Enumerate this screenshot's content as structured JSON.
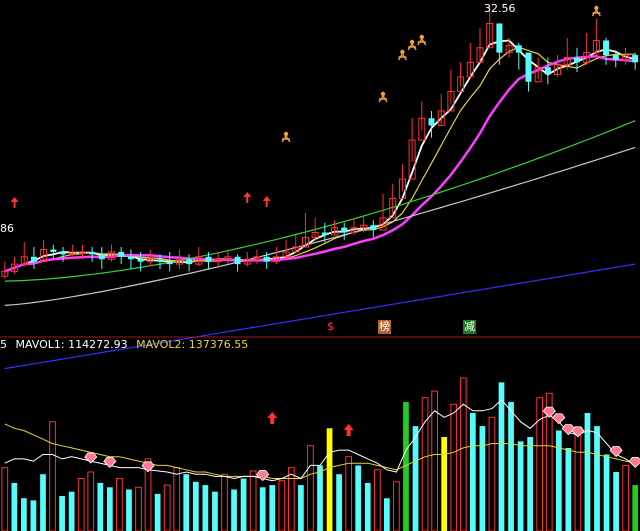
{
  "colors": {
    "background": "#000000",
    "up": "#ff3232",
    "down": "#54fcfc",
    "ma5": "#ffffff",
    "ma10": "#e6d23c",
    "ma20": "#ff3cff",
    "ma60": "#3ad03a",
    "ma120": "#c8c8c8",
    "ma250": "#3232ff",
    "vol_mavol1": "#ffffff",
    "vol_mavol2": "#e6d23c",
    "divider": "#a01818",
    "highlight_yellow": "#ffff00",
    "highlight_green": "#22cc22"
  },
  "markers": {
    "price_high": "32.56",
    "price_low": "86",
    "vol_prefix": "5"
  },
  "legend": {
    "mavol1_label": "MAVOL1: 114272.93",
    "mavol2_label": "MAVOL2: 137376.55"
  },
  "event_tags": [
    {
      "text": "$",
      "color": "#ff3232",
      "bg": "none"
    },
    {
      "text": "榜",
      "color": "#ffffff",
      "bg": "#b06028"
    },
    {
      "text": "减",
      "color": "#ffffff",
      "bg": "#207a20"
    }
  ],
  "chart_data": [
    {
      "type": "candlestick",
      "price_range": [
        20,
        33
      ],
      "close_start": 22.0,
      "closes": [
        22.0,
        22.3,
        22.6,
        22.4,
        22.9,
        22.8,
        22.7,
        22.8,
        22.8,
        22.7,
        22.5,
        22.8,
        22.6,
        22.5,
        22.4,
        22.5,
        22.4,
        22.3,
        22.5,
        22.3,
        22.6,
        22.4,
        22.5,
        22.6,
        22.3,
        22.5,
        22.6,
        22.4,
        22.6,
        22.8,
        23.0,
        23.4,
        23.6,
        23.5,
        23.8,
        23.6,
        23.8,
        23.9,
        23.7,
        24.2,
        25.0,
        25.8,
        27.4,
        28.3,
        28.0,
        28.6,
        29.4,
        30.0,
        30.6,
        31.2,
        32.2,
        31.0,
        31.3,
        31.0,
        29.8,
        30.4,
        30.1,
        30.5,
        30.8,
        30.6,
        31.0,
        31.5,
        30.9,
        30.7,
        30.9,
        30.6
      ],
      "highs": [
        22.4,
        22.6,
        23.2,
        23.0,
        23.3,
        23.1,
        23.0,
        23.1,
        23.1,
        23.0,
        23.0,
        23.1,
        23.0,
        22.9,
        22.8,
        22.9,
        22.7,
        22.8,
        22.9,
        22.7,
        23.0,
        22.8,
        22.8,
        22.9,
        22.7,
        22.8,
        22.9,
        22.8,
        23.0,
        23.3,
        23.5,
        24.4,
        24.2,
        24.0,
        24.1,
        24.0,
        24.2,
        24.3,
        24.1,
        25.2,
        25.6,
        26.4,
        28.3,
        29.0,
        28.6,
        29.3,
        30.3,
        30.6,
        31.4,
        32.0,
        32.9,
        32.2,
        31.6,
        31.4,
        30.6,
        30.8,
        30.8,
        30.9,
        31.6,
        31.2,
        31.8,
        32.4,
        31.6,
        31.1,
        31.2,
        31.0
      ],
      "lows": [
        21.7,
        21.9,
        22.2,
        22.1,
        22.5,
        22.5,
        22.4,
        22.5,
        22.5,
        22.4,
        22.1,
        22.4,
        22.3,
        22.1,
        22.0,
        22.2,
        22.1,
        22.0,
        22.1,
        22.0,
        22.2,
        22.1,
        22.2,
        22.3,
        22.0,
        22.2,
        22.3,
        22.1,
        22.3,
        22.5,
        22.8,
        23.0,
        23.3,
        23.2,
        23.5,
        23.3,
        23.5,
        23.6,
        23.4,
        23.8,
        24.3,
        25.3,
        26.5,
        27.8,
        27.5,
        28.0,
        28.9,
        29.6,
        30.0,
        30.6,
        31.2,
        30.5,
        30.8,
        30.3,
        29.4,
        29.9,
        29.7,
        30.0,
        30.3,
        30.2,
        30.5,
        30.8,
        30.5,
        30.4,
        30.5,
        30.3
      ],
      "ma_series": [
        {
          "name": "MA5",
          "start": 22.1,
          "end": 30.7
        },
        {
          "name": "MA10",
          "start": 22.2,
          "end": 30.8
        },
        {
          "name": "MA20",
          "start": 22.6,
          "end": 30.7
        },
        {
          "name": "MA60",
          "start": 21.6,
          "end": 28.2
        },
        {
          "name": "MA120",
          "start": 20.6,
          "end": 27.1
        },
        {
          "name": "MA250",
          "start": 18.0,
          "end": 22.3
        }
      ]
    },
    {
      "type": "bar",
      "series": [
        {
          "values": [
            58,
            44,
            30,
            28,
            52,
            100,
            32,
            36,
            48,
            54,
            44,
            40,
            48,
            38,
            40,
            66,
            34,
            42,
            58,
            52,
            45,
            42,
            36,
            52,
            38,
            48,
            55,
            40,
            42,
            46,
            58,
            42,
            78,
            60,
            94,
            52,
            68,
            60,
            44,
            56,
            30,
            45,
            118,
            96,
            122,
            128,
            86,
            116,
            140,
            108,
            96,
            104,
            136,
            118,
            82,
            86,
            122,
            126,
            92,
            76,
            88,
            108,
            96,
            70,
            54,
            60,
            42
          ]
        }
      ],
      "mavol1": [
        62,
        66,
        66,
        64,
        70,
        70,
        66,
        68,
        66,
        64,
        62,
        60,
        58,
        58,
        58,
        56,
        55,
        54,
        52,
        54,
        52,
        52,
        50,
        50,
        48,
        50,
        50,
        48,
        46,
        48,
        52,
        48,
        60,
        60,
        72,
        74,
        74,
        70,
        66,
        62,
        56,
        54,
        74,
        86,
        100,
        110,
        104,
        108,
        116,
        110,
        110,
        112,
        120,
        110,
        100,
        94,
        102,
        106,
        100,
        90,
        88,
        92,
        90,
        80,
        70,
        66,
        60
      ],
      "mavol2": [
        98,
        94,
        92,
        88,
        84,
        80,
        78,
        76,
        74,
        72,
        70,
        68,
        68,
        66,
        64,
        62,
        60,
        60,
        58,
        56,
        54,
        54,
        52,
        50,
        50,
        50,
        50,
        50,
        48,
        48,
        48,
        48,
        52,
        54,
        58,
        60,
        62,
        62,
        62,
        60,
        58,
        56,
        60,
        64,
        68,
        70,
        70,
        72,
        76,
        78,
        78,
        80,
        80,
        80,
        78,
        78,
        78,
        78,
        76,
        74,
        72,
        72,
        70,
        68,
        66,
        64,
        62
      ],
      "volume_max": 140
    }
  ]
}
